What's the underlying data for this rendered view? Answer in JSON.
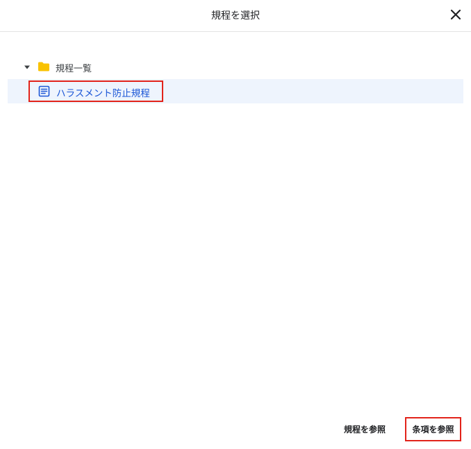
{
  "dialog": {
    "title": "規程を選択",
    "close_icon": "close-icon"
  },
  "tree": {
    "folder": {
      "label": "規程一覧",
      "icon": "folder-icon",
      "expanded": true,
      "icon_color": "#f9c200"
    },
    "items": [
      {
        "label": "ハラスメント防止規程",
        "icon": "document-icon",
        "selected": true
      }
    ]
  },
  "footer": {
    "view_regulation_label": "規程を参照",
    "view_article_label": "条項を参照"
  },
  "colors": {
    "accent": "#1a56d6",
    "selection_bg": "#eef4fd",
    "highlight_border": "#e2231a",
    "folder": "#f9c200"
  }
}
